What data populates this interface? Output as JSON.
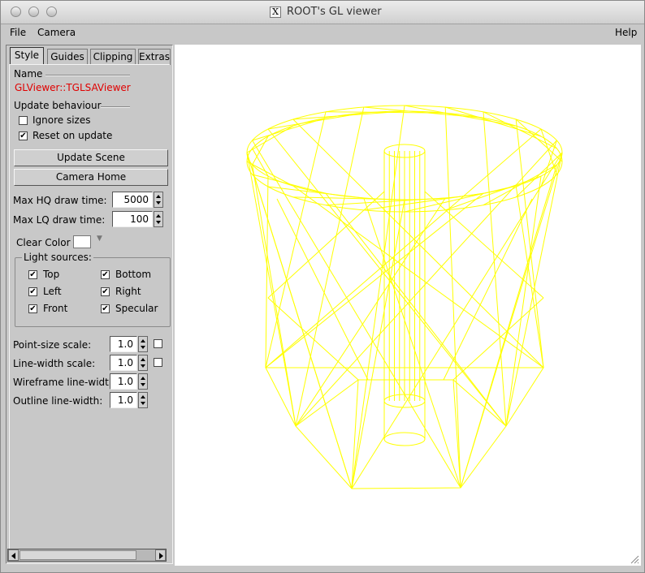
{
  "window": {
    "title": "ROOT's GL viewer"
  },
  "menubar": {
    "file": "File",
    "camera": "Camera",
    "help": "Help"
  },
  "tabs": [
    "Style",
    "Guides",
    "Clipping",
    "Extras"
  ],
  "style": {
    "name_heading": "Name",
    "viewer_name": "GLViewer::TGLSAViewer",
    "update_heading": "Update behaviour",
    "ignore_sizes": {
      "label": "Ignore sizes",
      "checked": false
    },
    "reset_on_update": {
      "label": "Reset on update",
      "checked": true
    },
    "update_scene_button": "Update Scene",
    "camera_home_button": "Camera Home",
    "max_hq": {
      "label": "Max HQ draw time:",
      "value": "5000"
    },
    "max_lq": {
      "label": "Max LQ draw time:",
      "value": "100"
    },
    "clear_color": {
      "label": "Clear Color",
      "color": "#ffffff"
    },
    "light_sources": {
      "heading": "Light sources:",
      "top": "Top",
      "bottom": "Bottom",
      "left": "Left",
      "right": "Right",
      "front": "Front",
      "specular": "Specular"
    },
    "point_size": {
      "label": "Point-size scale:",
      "value": "1.0"
    },
    "line_width": {
      "label": "Line-width scale:",
      "value": "1.0"
    },
    "wire_width": {
      "label": "Wireframe line-width:",
      "value": "1.0"
    },
    "outline_width": {
      "label": "Outline line-width:",
      "value": "1.0"
    }
  },
  "viewport": {
    "background": "#ffffff",
    "wire_color": "#ffff00"
  }
}
